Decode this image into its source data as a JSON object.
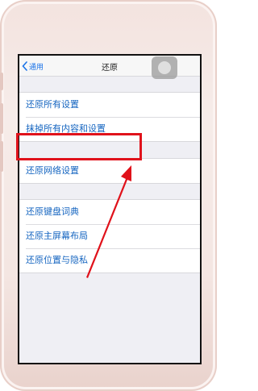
{
  "nav": {
    "back_label": "通用",
    "title": "还原"
  },
  "groups": [
    {
      "items": [
        {
          "label": "还原所有设置"
        },
        {
          "label": "抹掉所有内容和设置"
        }
      ]
    },
    {
      "items": [
        {
          "label": "还原网络设置"
        }
      ]
    },
    {
      "items": [
        {
          "label": "还原键盘词典"
        },
        {
          "label": "还原主屏幕布局"
        },
        {
          "label": "还原位置与隐私"
        }
      ]
    }
  ],
  "colors": {
    "accent": "#1565c0",
    "annotation": "#e0121b",
    "background": "#efeff4"
  }
}
